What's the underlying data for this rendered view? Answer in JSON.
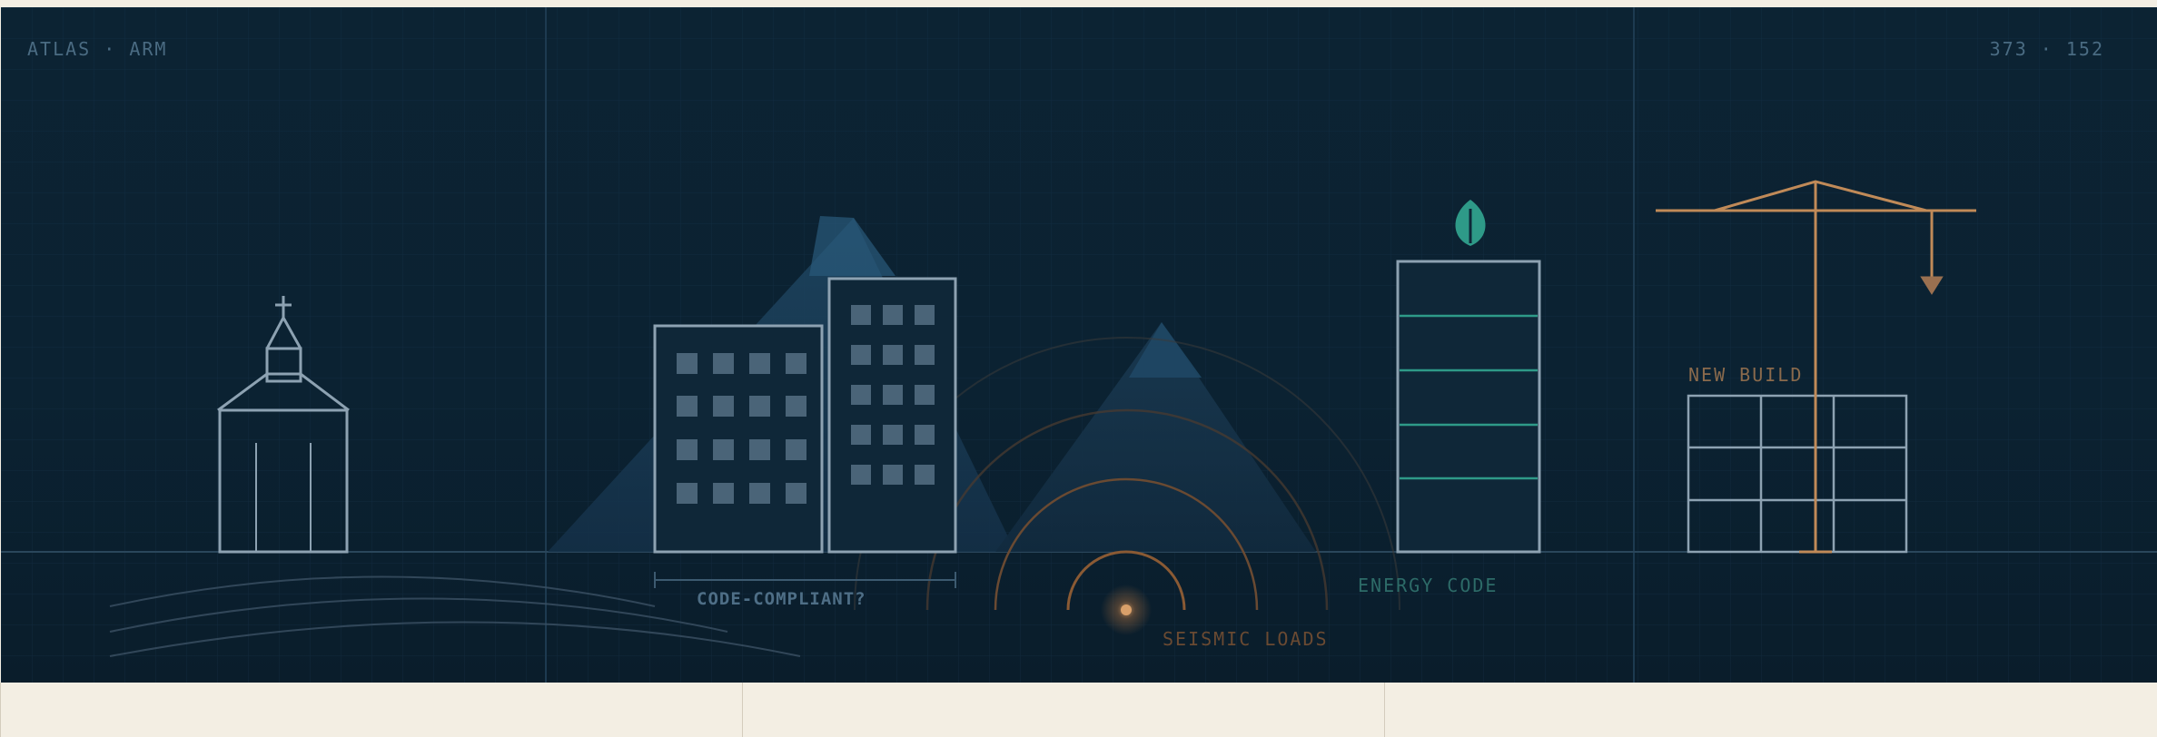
{
  "header": {
    "left_label": "ATLAS · ARM",
    "right_label": "373 · 152"
  },
  "annotations": {
    "code_compliant": "CODE-COMPLIANT?",
    "energy_code": "ENERGY CODE",
    "seismic_loads": "SEISMIC LOADS",
    "new_build": "NEW BUILD"
  },
  "icons": {
    "church": "church-icon",
    "office": "office-buildings-icon",
    "seismic": "seismic-waves-icon",
    "tower": "energy-tower-icon",
    "leaf": "leaf-icon",
    "crane": "crane-icon"
  },
  "colors": {
    "background": "#0b2232",
    "line": "#8da2b2",
    "energy": "#2e9a88",
    "crane": "#c08a58",
    "seismic": "#6a4a32"
  }
}
